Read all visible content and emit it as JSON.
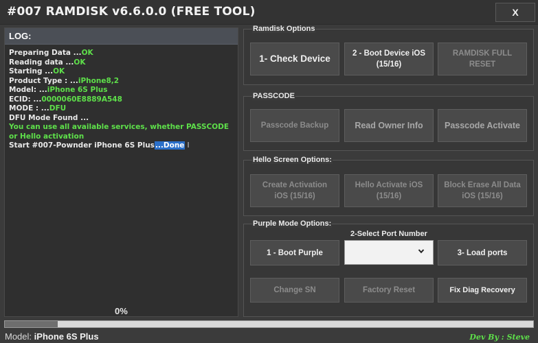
{
  "window": {
    "title": "#007 RAMDISK v6.6.0.0 (FREE TOOL)",
    "close_label": "X"
  },
  "log": {
    "header": "LOG:",
    "lines": [
      {
        "label": "Preparing Data ...",
        "value": "OK"
      },
      {
        "label": "Reading data ...",
        "value": "OK"
      },
      {
        "label": "Starting ...",
        "value": "OK"
      },
      {
        "label": "Product Type : ...",
        "value": "iPhone8,2"
      },
      {
        "label": "Model: ...",
        "value": "iPhone 6S Plus"
      },
      {
        "label": "ECID: ...",
        "value": "0000060E8889A548"
      },
      {
        "label": "MODE : ...",
        "value": "DFU"
      }
    ],
    "dfu_found": " DFU Mode Found  ...",
    "services_message": "You can use all available services, whether PASSCODE  or Hello activation",
    "start_prefix": "Start #007-Pownder iPhone 6S Plus",
    "start_done": "...Done",
    "cursor": "I",
    "progress_text": "0%",
    "progress_fraction": 0.1
  },
  "ramdisk": {
    "title": "Ramdisk Options",
    "check_device": "1- Check Device",
    "boot_device": "2 - Boot Device iOS (15/16)",
    "ramdisk_reset": "RAMDISK FULL RESET"
  },
  "passcode": {
    "title": "PASSCODE",
    "backup": "Passcode Backup",
    "read_owner": "Read Owner Info",
    "activate": "Passcode Activate"
  },
  "hello": {
    "title": "Hello Screen Options:",
    "create_activation": "Create Activation iOS (15/16)",
    "hello_activate": "Hello Activate iOS (15/16)",
    "block_erase": "Block Erase All Data iOS (15/16)"
  },
  "purple": {
    "title": "Purple Mode Options:",
    "port_label": "2-Select Port Number",
    "boot_purple": "1 - Boot Purple",
    "port_value": "",
    "load_ports": "3- Load ports",
    "change_sn": "Change SN",
    "factory_reset": "Factory Reset",
    "fix_diag": "Fix Diag Recovery"
  },
  "status": {
    "model_label": "Model:",
    "model_value": "iPhone 6S Plus",
    "dev_by": "Dev By : Steve"
  },
  "colors": {
    "background": "#3b3b3b",
    "log_ok": "#5ee04a",
    "selection": "#2a6fc9",
    "disabled_text": "#8c8c8c"
  }
}
